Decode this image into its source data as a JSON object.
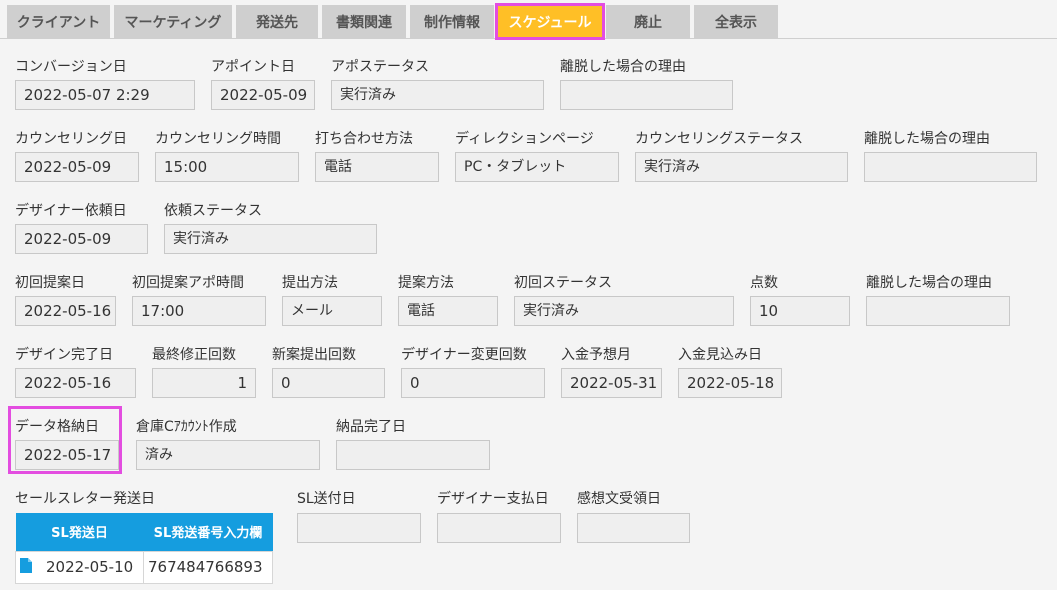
{
  "tabs": [
    {
      "label": "クライアント"
    },
    {
      "label": "マーケティング"
    },
    {
      "label": "発送先"
    },
    {
      "label": "書類関連"
    },
    {
      "label": "制作情報"
    },
    {
      "label": "スケジュール"
    },
    {
      "label": "廃止"
    },
    {
      "label": "全表示"
    }
  ],
  "row1": {
    "conversion_date": {
      "label": "コンバージョン日",
      "value": "2022-05-07 2:29"
    },
    "appoint_date": {
      "label": "アポイント日",
      "value": "2022-05-09"
    },
    "appo_status": {
      "label": "アポステータス",
      "value": "実行済み"
    },
    "dropout_reason": {
      "label": "離脱した場合の理由",
      "value": ""
    }
  },
  "row2": {
    "counseling_date": {
      "label": "カウンセリング日",
      "value": "2022-05-09"
    },
    "counseling_time": {
      "label": "カウンセリング時間",
      "value": "15:00"
    },
    "meeting_method": {
      "label": "打ち合わせ方法",
      "value": "電話"
    },
    "direction_page": {
      "label": "ディレクションページ",
      "value": "PC・タブレット"
    },
    "counseling_status": {
      "label": "カウンセリングステータス",
      "value": "実行済み"
    },
    "dropout_reason": {
      "label": "離脱した場合の理由",
      "value": ""
    }
  },
  "row3": {
    "designer_request_date": {
      "label": "デザイナー依頼日",
      "value": "2022-05-09"
    },
    "request_status": {
      "label": "依頼ステータス",
      "value": "実行済み"
    }
  },
  "row4": {
    "first_proposal_date": {
      "label": "初回提案日",
      "value": "2022-05-16"
    },
    "first_proposal_time": {
      "label": "初回提案アポ時間",
      "value": "17:00"
    },
    "submission_method": {
      "label": "提出方法",
      "value": "メール"
    },
    "proposal_method": {
      "label": "提案方法",
      "value": "電話"
    },
    "first_status": {
      "label": "初回ステータス",
      "value": "実行済み"
    },
    "points": {
      "label": "点数",
      "value": "10"
    },
    "dropout_reason": {
      "label": "離脱した場合の理由",
      "value": ""
    }
  },
  "row5": {
    "design_complete_date": {
      "label": "デザイン完了日",
      "value": "2022-05-16"
    },
    "final_revision_count": {
      "label": "最終修正回数",
      "value": "1"
    },
    "new_proposal_count": {
      "label": "新案提出回数",
      "value": "0"
    },
    "designer_change_count": {
      "label": "デザイナー変更回数",
      "value": "0"
    },
    "expected_payment_month": {
      "label": "入金予想月",
      "value": "2022-05-31"
    },
    "expected_payment_date": {
      "label": "入金見込み日",
      "value": "2022-05-18"
    }
  },
  "row6": {
    "data_storage_date": {
      "label": "データ格納日",
      "value": "2022-05-17"
    },
    "warehouse_account": {
      "label": "倉庫Cｱｶｳﾝﾄ作成",
      "value": "済み"
    },
    "delivery_complete_date": {
      "label": "納品完了日",
      "value": ""
    }
  },
  "row7": {
    "sales_letter_label": "セールスレター発送日",
    "sl_table": {
      "headers": [
        "SL発送日",
        "SL発送番号入力欄"
      ],
      "rows": [
        {
          "date": "2022-05-10",
          "number": "767484766893"
        }
      ]
    },
    "sl_send_date": {
      "label": "SL送付日",
      "value": ""
    },
    "designer_payment_date": {
      "label": "デザイナー支払日",
      "value": ""
    },
    "feedback_received_date": {
      "label": "感想文受領日",
      "value": ""
    }
  },
  "colors": {
    "active_tab": "#ffbf26",
    "highlight": "#e34de0",
    "table_header": "#159ddf"
  }
}
